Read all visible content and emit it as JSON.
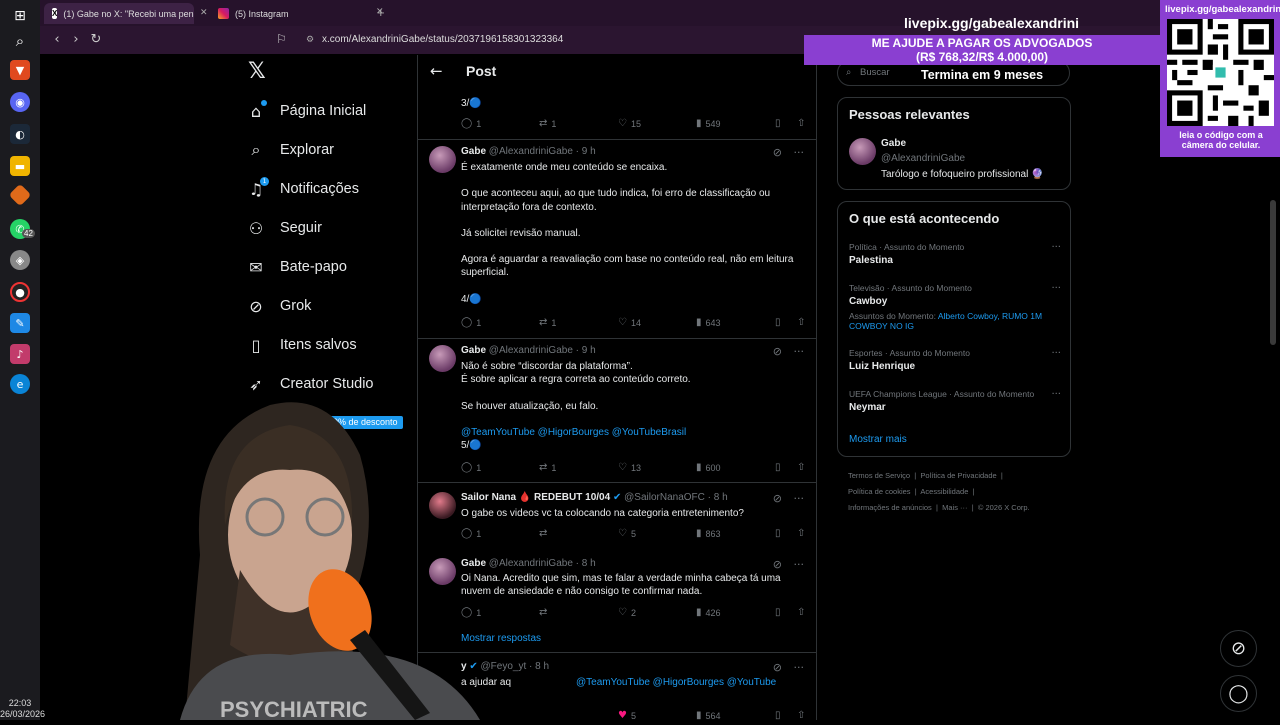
{
  "taskbar": {
    "time": "22:03",
    "date": "26/03/2026",
    "whatsapp_count": "42"
  },
  "browser": {
    "tabs": [
      {
        "label": "(1) Gabe no X: \"Recebi uma pena...",
        "icon": "x-icon"
      },
      {
        "label": "(5) Instagram",
        "icon": "instagram-icon"
      }
    ],
    "url": "x.com/AlexandriniGabe/status/2037196158301323364"
  },
  "nav": {
    "items": [
      {
        "label": "Página Inicial",
        "icon": "home-icon"
      },
      {
        "label": "Explorar",
        "icon": "search-icon"
      },
      {
        "label": "Notificações",
        "icon": "bell-icon",
        "badge": "1"
      },
      {
        "label": "Seguir",
        "icon": "follow-icon"
      },
      {
        "label": "Bate-papo",
        "icon": "mail-icon"
      },
      {
        "label": "Grok",
        "icon": "grok-icon"
      },
      {
        "label": "Itens salvos",
        "icon": "bookmark-icon"
      },
      {
        "label": "Creator Studio",
        "icon": "rocket-icon"
      }
    ],
    "promo": "60% de desconto"
  },
  "timeline": {
    "title": "Post",
    "show_replies": "Mostrar respostas",
    "tweets": [
      {
        "lines": [
          "3/🔵"
        ],
        "replies": "1",
        "retweets": "1",
        "likes": "15",
        "views": "549"
      },
      {
        "name": "Gabe",
        "handle": "@AlexandriniGabe · 9 h",
        "lines": [
          "É exatamente onde meu conteúdo se encaixa.",
          "",
          "O que aconteceu aqui, ao que tudo indica, foi erro de classificação ou",
          "interpretação fora de contexto.",
          "",
          "Já solicitei revisão manual.",
          "",
          "Agora é aguardar a reavaliação com base no conteúdo real, não em leitura",
          "superficial.",
          "",
          "4/🔵"
        ],
        "replies": "1",
        "retweets": "1",
        "likes": "14",
        "views": "643"
      },
      {
        "name": "Gabe",
        "handle": "@AlexandriniGabe · 9 h",
        "lines": [
          "Não é sobre “discordar da plataforma”.",
          "É sobre aplicar a regra correta ao conteúdo correto.",
          "",
          "Se houver atualização, eu falo.",
          ""
        ],
        "mentions": "@TeamYouTube @HigorBourges @YouTubeBrasil",
        "tail": "5/🔵",
        "replies": "1",
        "retweets": "1",
        "likes": "13",
        "views": "600"
      },
      {
        "name": "Sailor Nana 🩸 REDEBUT 10/04",
        "handle": "@SailorNanaOFC · 8 h",
        "lines": [
          "O gabe os videos vc ta colocando na categoria entretenimento?"
        ],
        "replies": "1",
        "retweets": "",
        "likes": "5",
        "views": "863"
      },
      {
        "name": "Gabe",
        "handle": "@AlexandriniGabe · 8 h",
        "lines": [
          "Oi Nana. Acredito que sim, mas te falar a verdade minha cabeça tá uma",
          "nuvem de ansiedade e não consigo te confirmar nada."
        ],
        "replies": "1",
        "retweets": "",
        "likes": "2",
        "views": "426"
      },
      {
        "name": "y",
        "handle": "@Feyo_yt · 8 h",
        "lines": [
          "a ajudar aq"
        ],
        "mentions": "@TeamYouTube @HigorBourges @YouTube",
        "likes": "5",
        "views": "564"
      }
    ]
  },
  "sidebar": {
    "search_placeholder": "Buscar",
    "relevant": {
      "title": "Pessoas relevantes",
      "name": "Gabe",
      "handle": "@AlexandriniGabe",
      "bio": "Tarólogo e fofoqueiro profissional 🔮"
    },
    "trending": {
      "title": "O que está acontecendo",
      "items": [
        {
          "category": "Política · Assunto do Momento",
          "name": "Palestina"
        },
        {
          "category": "Televisão · Assunto do Momento",
          "name": "Cawboy",
          "related_label": "Assuntos do Momento:",
          "related": "Alberto Cowboy, RUMO 1M COWBOY NO IG"
        },
        {
          "category": "Esportes · Assunto do Momento",
          "name": "Luiz Henrique"
        },
        {
          "category": "UEFA Champions League · Assunto do Momento",
          "name": "Neymar"
        }
      ],
      "show_more": "Mostrar mais"
    },
    "footer": [
      "Termos de Serviço",
      "Política de Privacidade",
      "Política de cookies",
      "Acessibilidade",
      "Informações de anúncios",
      "Mais ···",
      "© 2026 X Corp."
    ]
  },
  "overlay": {
    "livepix": "livepix.gg/gabealexandrini",
    "banner_line1": "ME AJUDE A PAGAR OS ADVOGADOS",
    "banner_line2": "(R$ 768,32/R$ 4.000,00)",
    "ends": "Termina em 9 meses",
    "progress_fraction": 0.192,
    "qr_title": "livepix.gg/gabealexandrini",
    "qr_footer": "leia o código com a câmera do celular."
  },
  "colors": {
    "accent": "#1d9bf0",
    "overlay_purple": "#8a3fd1",
    "browser_bg": "#2b1530"
  }
}
